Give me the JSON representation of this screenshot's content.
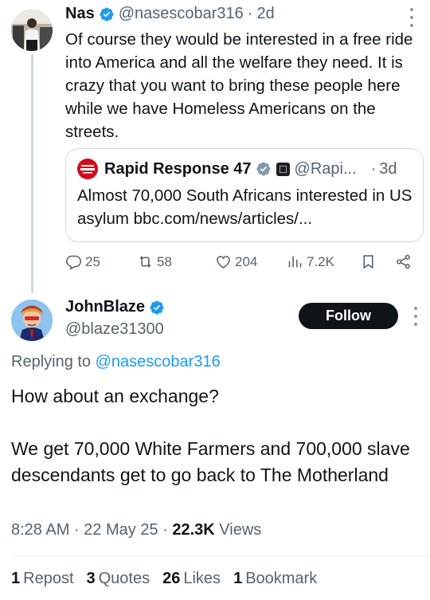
{
  "parent_tweet": {
    "author_name": "Nas",
    "handle": "@nasescobar316",
    "separator": "·",
    "time": "2d",
    "text": "Of course they would be interested in a free ride into America and all the welfare they need. It is crazy that you want to bring these people here while we have Homeless Americans on the streets.",
    "quoted_tweet": {
      "author_name": "Rapid Response 47",
      "handle": "@Rapi...",
      "separator": "·",
      "time": "3d",
      "text": "Almost 70,000 South Africans interested in US asylum bbc.com/news/articles/..."
    },
    "actions": {
      "replies": "25",
      "reposts": "58",
      "likes": "204",
      "views": "7.2K"
    }
  },
  "main_tweet": {
    "author_name": "JohnBlaze",
    "handle": "@blaze31300",
    "follow_label": "Follow",
    "replying_prefix": "Replying to ",
    "replying_to": "@nasescobar316",
    "text": "How about an exchange?\n\nWe get 70,000 White Farmers and  700,000 slave descendants get to go back to The Motherland",
    "time": "8:28 AM",
    "date": "22 May 25",
    "views_count": "22.3K",
    "views_label": "Views",
    "meta_separator": " · ",
    "stats": {
      "reposts_count": "1",
      "reposts_label": "Repost",
      "quotes_count": "3",
      "quotes_label": "Quotes",
      "likes_count": "26",
      "likes_label": "Likes",
      "bookmarks_count": "1",
      "bookmarks_label": "Bookmark"
    }
  },
  "colors": {
    "verified": "#1d9bf0",
    "secondary_text": "#536471",
    "link": "#1d9bf0",
    "follow_button": "#0f1419"
  },
  "icons": {
    "verified": "verified-badge-icon",
    "more": "more-options-icon",
    "reply": "reply-icon",
    "repost": "repost-icon",
    "like": "heart-icon",
    "views": "views-chart-icon",
    "bookmark": "bookmark-icon",
    "share": "share-icon"
  }
}
